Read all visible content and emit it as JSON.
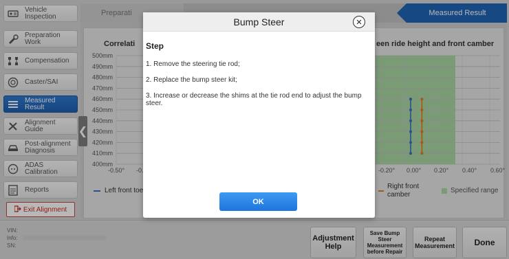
{
  "sidebar": {
    "items": [
      {
        "label": "Vehicle\nInspection",
        "icon": "vehicle-inspection-icon",
        "active": false
      },
      {
        "label": "Preparation\nWork",
        "icon": "preparation-icon",
        "active": false
      },
      {
        "label": "Compensation",
        "icon": "compensation-icon",
        "active": false
      },
      {
        "label": "Caster/SAI",
        "icon": "caster-icon",
        "active": false
      },
      {
        "label": "Measured\nResult",
        "icon": "measured-result-icon",
        "active": true
      },
      {
        "label": "Alignment\nGuide",
        "icon": "alignment-guide-icon",
        "active": false
      },
      {
        "label": "Post-alignment\nDiagnosis",
        "icon": "post-alignment-icon",
        "active": false
      },
      {
        "label": "ADAS\nCalibration",
        "icon": "adas-icon",
        "active": false
      },
      {
        "label": "Reports",
        "icon": "reports-icon",
        "active": false
      }
    ],
    "exit_label": "Exit Alignment"
  },
  "tabs": {
    "prep": "Preparati",
    "measured": "Measured Result"
  },
  "chart": {
    "title_left": "Correlati",
    "title_right": "een ride height and front camber",
    "legend_left": "Left front toe",
    "legend_right": "Right front\ncamber",
    "legend_range": "Specified range",
    "colors": {
      "range": "#a9d7a3",
      "left": "#3c70c8",
      "right": "#e07d1a"
    }
  },
  "chart_data": {
    "type": "scatter",
    "y_ticks": [
      "500mm",
      "490mm",
      "480mm",
      "470mm",
      "460mm",
      "450mm",
      "440mm",
      "430mm",
      "420mm",
      "410mm",
      "400mm"
    ],
    "x_ticks_left": [
      "-0.50°",
      "-0."
    ],
    "x_ticks_right": [
      "-0.20°",
      "0.00°",
      "0.20°",
      "0.40°",
      "0.60°"
    ],
    "ylim": [
      400,
      500
    ],
    "series": [
      {
        "name": "Left front toe",
        "x": [
          0,
          0,
          0,
          0,
          0,
          0,
          0
        ],
        "y": [
          460,
          450,
          440,
          430,
          420,
          410,
          460
        ]
      },
      {
        "name": "Right front camber",
        "x": [
          0.08,
          0.08,
          0.08,
          0.08,
          0.08,
          0.08
        ],
        "y": [
          460,
          450,
          440,
          430,
          420,
          410
        ]
      }
    ]
  },
  "bottom": {
    "vin_label": "VIN:",
    "info_label": "Info:",
    "sn_label": "SN:",
    "adjustment_help": "Adjustment\nHelp",
    "save_bump": "Save Bump\nSteer\nMeasurement\nbefore Repair",
    "repeat": "Repeat\nMeasurement",
    "done": "Done"
  },
  "dialog": {
    "title": "Bump Steer",
    "step_title": "Step",
    "steps": [
      "1. Remove the steering tie rod;",
      "2. Replace the bump steer kit;",
      "3. Increase or decrease the shims at the tie rod end to adjust the bump steer."
    ],
    "ok": "OK"
  }
}
